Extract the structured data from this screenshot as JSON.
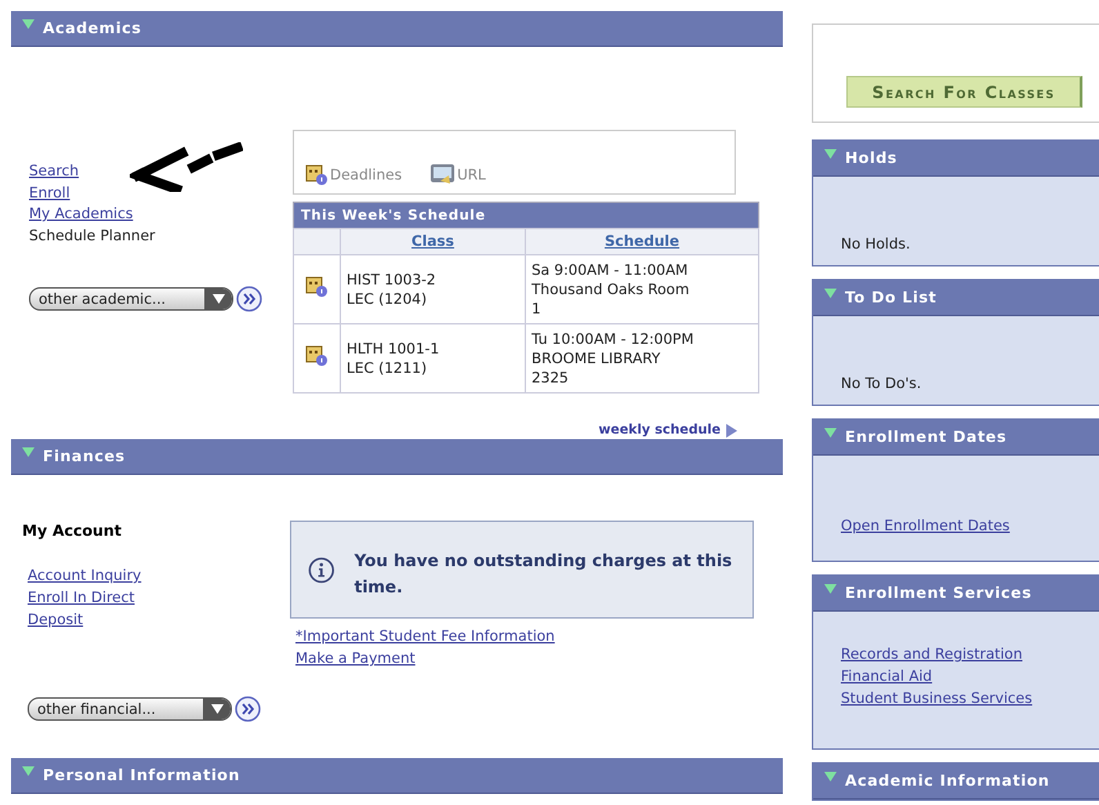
{
  "academics": {
    "title": "Academics",
    "expanded": true,
    "links": [
      {
        "label": "Search",
        "kind": "link"
      },
      {
        "label": "Enroll",
        "kind": "link"
      },
      {
        "label": "My Academics",
        "kind": "link"
      },
      {
        "label": "Schedule Planner",
        "kind": "text"
      }
    ],
    "select": "other academic...",
    "shortcuts": [
      {
        "label": "Deadlines",
        "kind": "calendar"
      },
      {
        "label": "URL",
        "kind": "monitor"
      }
    ],
    "schedule": {
      "title": "This Week's Schedule",
      "columns": [
        "Class",
        "Schedule"
      ],
      "rows": [
        {
          "class": [
            "HIST 1003-2",
            "LEC (1204)"
          ],
          "schedule": [
            "Sa 9:00AM - 11:00AM",
            "Thousand Oaks Room",
            "1"
          ]
        },
        {
          "class": [
            "HLTH 1001-1",
            "LEC (1211)"
          ],
          "schedule": [
            "Tu 10:00AM - 12:00PM",
            "BROOME LIBRARY",
            "2325"
          ]
        }
      ]
    },
    "weekly_link": "weekly schedule"
  },
  "finances": {
    "title": "Finances",
    "expanded": true,
    "account_title": "My Account",
    "links": [
      "Account Inquiry",
      "Enroll In Direct",
      "Deposit"
    ],
    "message": "You have no outstanding charges at this time.",
    "info_links": [
      "*Important Student Fee Information",
      "Make a Payment"
    ],
    "select": "other financial..."
  },
  "personal": {
    "title": "Personal Information",
    "expanded": true
  },
  "search_button": "Search For Classes",
  "panels": [
    {
      "title": "Holds",
      "expanded": true,
      "kind": "text",
      "items": [
        "No Holds."
      ]
    },
    {
      "title": "To Do List",
      "expanded": true,
      "kind": "text",
      "items": [
        "No To Do's."
      ]
    },
    {
      "title": "Enrollment Dates",
      "expanded": true,
      "kind": "links",
      "items": [
        "Open Enrollment Dates"
      ]
    },
    {
      "title": "Enrollment Services",
      "expanded": true,
      "kind": "links",
      "items": [
        "Records and Registration",
        "Financial Aid",
        "Student Business Services"
      ]
    },
    {
      "title": "Academic Information",
      "expanded": true,
      "kind": "links"
    }
  ]
}
